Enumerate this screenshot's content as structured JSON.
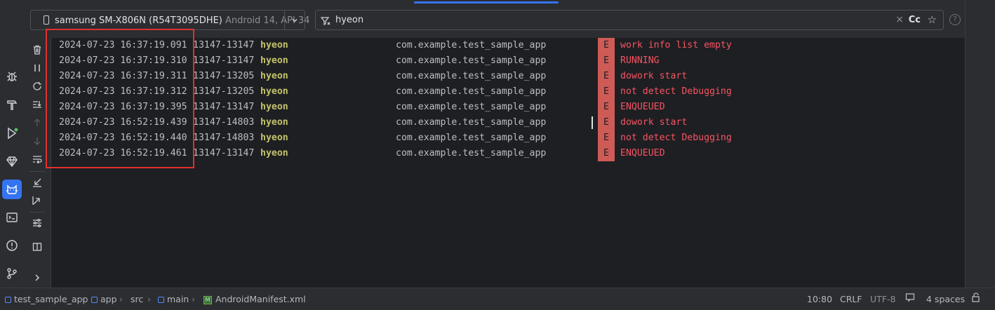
{
  "device_selector": {
    "name": "samsung SM-X806N (R54T3095DHE)",
    "api": "Android 14, API 34"
  },
  "filter": {
    "query": "hyeon",
    "clear": "×",
    "match_case": "Cc",
    "favorite": "☆"
  },
  "help": "?",
  "log_rows": [
    {
      "timestamp": "2024-07-23 16:37:19.091",
      "pid": "13147-13147",
      "tag": "hyeon",
      "package": "com.example.test_sample_app",
      "level": "E",
      "message": "work info list empty"
    },
    {
      "timestamp": "2024-07-23 16:37:19.310",
      "pid": "13147-13147",
      "tag": "hyeon",
      "package": "com.example.test_sample_app",
      "level": "E",
      "message": "RUNNING"
    },
    {
      "timestamp": "2024-07-23 16:37:19.311",
      "pid": "13147-13205",
      "tag": "hyeon",
      "package": "com.example.test_sample_app",
      "level": "E",
      "message": "dowork start"
    },
    {
      "timestamp": "2024-07-23 16:37:19.312",
      "pid": "13147-13205",
      "tag": "hyeon",
      "package": "com.example.test_sample_app",
      "level": "E",
      "message": "not detect Debugging"
    },
    {
      "timestamp": "2024-07-23 16:37:19.395",
      "pid": "13147-13147",
      "tag": "hyeon",
      "package": "com.example.test_sample_app",
      "level": "E",
      "message": "ENQUEUED"
    },
    {
      "timestamp": "2024-07-23 16:52:19.439",
      "pid": "13147-14803",
      "tag": "hyeon",
      "package": "com.example.test_sample_app",
      "level": "E",
      "message": "dowork start"
    },
    {
      "timestamp": "2024-07-23 16:52:19.440",
      "pid": "13147-14803",
      "tag": "hyeon",
      "package": "com.example.test_sample_app",
      "level": "E",
      "message": "not detect Debugging"
    },
    {
      "timestamp": "2024-07-23 16:52:19.461",
      "pid": "13147-13147",
      "tag": "hyeon",
      "package": "com.example.test_sample_app",
      "level": "E",
      "message": "ENQUEUED"
    }
  ],
  "breadcrumb": [
    "test_sample_app",
    "app",
    "src",
    "main",
    "AndroidManifest.xml"
  ],
  "status": {
    "position": "10:80",
    "line_sep": "CRLF",
    "encoding": "UTF-8",
    "indent": "4 spaces"
  },
  "icons": {
    "tool_strip": [
      "bug-icon",
      "build-hammer-icon",
      "run-icon",
      "gem-icon",
      "logcat-icon",
      "terminal-icon",
      "problems-icon",
      "git-icon"
    ],
    "logcat_toolbar": [
      "trash-icon",
      "pause-icon",
      "restart-icon",
      "scroll-to-end-icon",
      "up-arrow-icon",
      "down-arrow-icon",
      "soft-wrap-icon",
      "import-icon",
      "export-icon",
      "settings-sliders-icon",
      "split-view-icon",
      "expand-chevron-icon"
    ]
  },
  "colors": {
    "accent": "#3574f0",
    "error_badge": "#cf5b56",
    "error_text": "#f75464",
    "tag": "#c3c36c",
    "highlight_box": "#e03030"
  }
}
